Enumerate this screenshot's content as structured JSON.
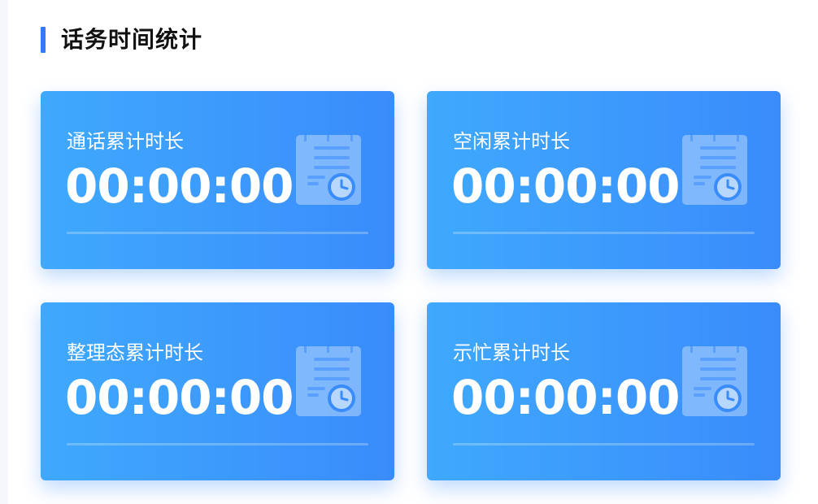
{
  "section": {
    "title": "话务时间统计"
  },
  "cards": [
    {
      "label": "通话累计时长",
      "value": "00:00:00",
      "icon": "clipboard-clock-icon"
    },
    {
      "label": "空闲累计时长",
      "value": "00:00:00",
      "icon": "clipboard-clock-icon"
    },
    {
      "label": "整理态累计时长",
      "value": "00:00:00",
      "icon": "clipboard-clock-icon"
    },
    {
      "label": "示忙累计时长",
      "value": "00:00:00",
      "icon": "clipboard-clock-icon"
    }
  ],
  "colors": {
    "accent": "#2f7cf6",
    "card_gradient_start": "#3fa9fd",
    "card_gradient_end": "#3a8cfb"
  }
}
